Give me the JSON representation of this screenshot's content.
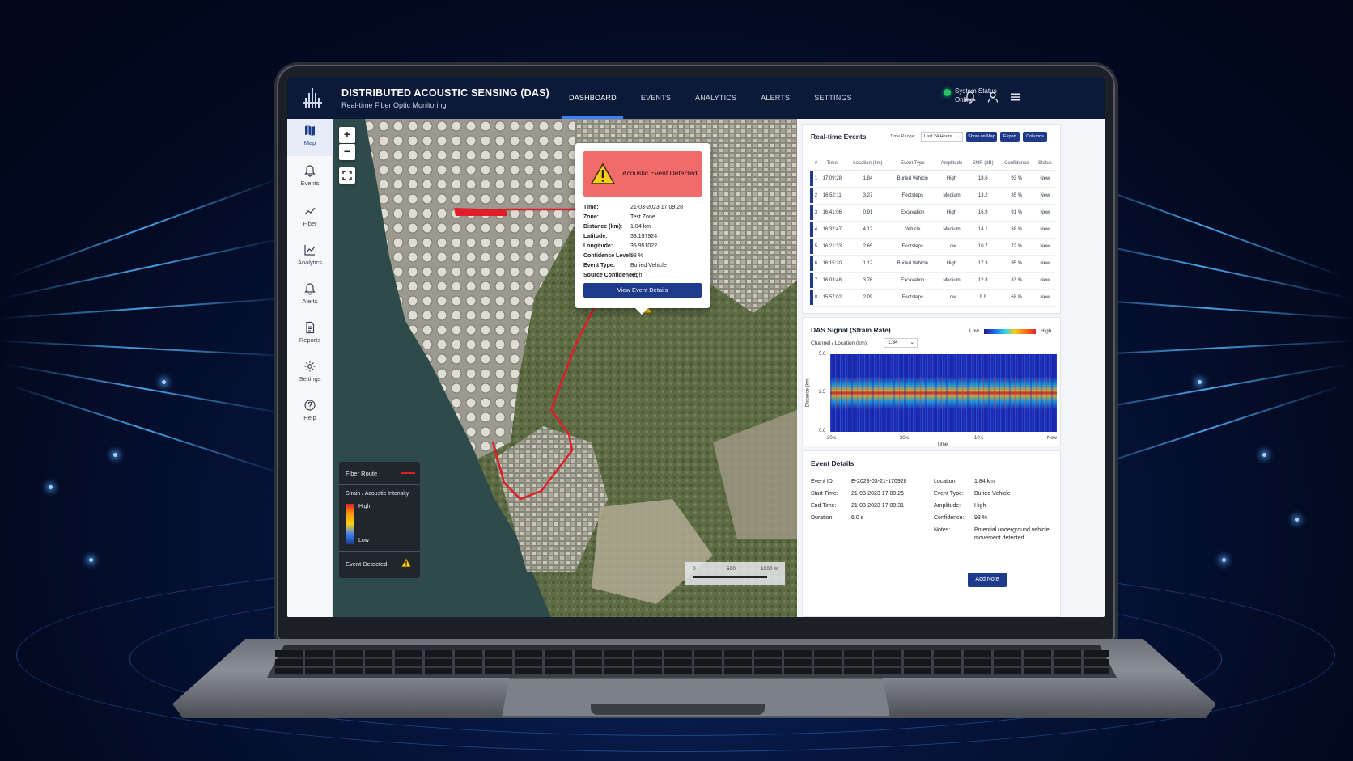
{
  "header": {
    "title": "DISTRIBUTED ACOUSTIC SENSING (DAS)",
    "subtitle": "Real-time Fiber Optic Monitoring",
    "nav": [
      "DASHBOARD",
      "EVENTS",
      "ANALYTICS",
      "ALERTS",
      "SETTINGS"
    ],
    "active_nav": "DASHBOARD",
    "status_label": "System Status",
    "status_value": "Online",
    "status_color": "#22c55e"
  },
  "sidebar": {
    "items": [
      {
        "label": "Map",
        "icon": "map-icon"
      },
      {
        "label": "Events",
        "icon": "bell-icon"
      },
      {
        "label": "Fiber",
        "icon": "line-chart-icon"
      },
      {
        "label": "Analytics",
        "icon": "analytics-icon"
      },
      {
        "label": "Alerts",
        "icon": "bell-icon"
      },
      {
        "label": "Reports",
        "icon": "document-icon"
      },
      {
        "label": "Settings",
        "icon": "gear-icon"
      },
      {
        "label": "Help",
        "icon": "help-icon"
      }
    ]
  },
  "map": {
    "zoom_in": "+",
    "zoom_out": "−",
    "popup": {
      "title": "Acoustic Event Detected",
      "fields": [
        {
          "k": "Time:",
          "v": "21-03-2023 17:09:28"
        },
        {
          "k": "Zone:",
          "v": "Test Zone"
        },
        {
          "k": "Distance (km):",
          "v": "1.84 km"
        },
        {
          "k": "Latitude:",
          "v": "33.197924"
        },
        {
          "k": "Longitude:",
          "v": "35.951022"
        },
        {
          "k": "Confidence Level:",
          "v": "93 %"
        },
        {
          "k": "Event Type:",
          "v": "Buried Vehicle"
        },
        {
          "k": "Source Confidence:",
          "v": "High"
        }
      ],
      "button": "View Event Details"
    },
    "legend": {
      "fiber_route": "Fiber Route",
      "intensity_title": "Strain / Acoustic Intensity",
      "high": "High",
      "low": "Low",
      "event_detected": "Event Detected"
    },
    "scale": {
      "ticks": [
        "0",
        "500",
        "1000 m"
      ]
    }
  },
  "events_panel": {
    "title": "Real-time Events",
    "time_range_label": "Time Range:",
    "time_range_value": "Last 24 Hours",
    "buttons": [
      "Show on Map",
      "Export",
      "Columns"
    ],
    "columns": [
      "#",
      "Time",
      "Location (km)",
      "Event Type",
      "Amplitude",
      "SNR (dB)",
      "Confidence",
      "Status"
    ],
    "rows": [
      [
        "1",
        "17:09:28",
        "1.84",
        "Buried Vehicle",
        "High",
        "18.6",
        "93 %",
        "New"
      ],
      [
        "2",
        "16:52:11",
        "3.27",
        "Footsteps",
        "Medium",
        "13.2",
        "85 %",
        "New"
      ],
      [
        "3",
        "16:41:06",
        "0.91",
        "Excavation",
        "High",
        "16.9",
        "91 %",
        "New"
      ],
      [
        "4",
        "16:32:47",
        "4.12",
        "Vehicle",
        "Medium",
        "14.1",
        "88 %",
        "New"
      ],
      [
        "5",
        "16:21:33",
        "2.65",
        "Footsteps",
        "Low",
        "10.7",
        "72 %",
        "New"
      ],
      [
        "6",
        "16:15:20",
        "1.12",
        "Buried Vehicle",
        "High",
        "17.3",
        "95 %",
        "New"
      ],
      [
        "7",
        "16:03:48",
        "3.76",
        "Excavation",
        "Medium",
        "12.8",
        "83 %",
        "New"
      ],
      [
        "8",
        "15:57:02",
        "2.09",
        "Footsteps",
        "Low",
        "9.9",
        "68 %",
        "New"
      ]
    ]
  },
  "signal_panel": {
    "title": "DAS Signal (Strain Rate)",
    "low": "Low",
    "high": "High",
    "channel_label": "Channel / Location (km):",
    "channel_value": "1.84",
    "y_ticks": [
      "5.0",
      "2.5",
      "0.0"
    ],
    "y_label": "Distance (km)",
    "x_ticks": [
      "-30 s",
      "-20 s",
      "-10 s",
      "Now"
    ],
    "x_label": "Time"
  },
  "details_panel": {
    "title": "Event Details",
    "left": [
      {
        "k": "Event ID:",
        "v": "E-2023-03-21-170928"
      },
      {
        "k": "Start Time:",
        "v": "21-03-2023 17:09:25"
      },
      {
        "k": "End Time:",
        "v": "21-03-2023 17:09:31"
      },
      {
        "k": "Duration:",
        "v": "6.0 s"
      }
    ],
    "right": [
      {
        "k": "Location:",
        "v": "1.84 km"
      },
      {
        "k": "Event Type:",
        "v": "Buried Vehicle"
      },
      {
        "k": "Amplitude:",
        "v": "High"
      },
      {
        "k": "Confidence:",
        "v": "93 %"
      },
      {
        "k": "Notes:",
        "v": "Potential underground vehicle"
      },
      {
        "k": "",
        "v": "movement detected."
      }
    ],
    "button": "Add Note"
  },
  "colors": {
    "accent": "#1e3a8a",
    "alert": "#f26b6b",
    "fiber": "#e11d2a"
  }
}
